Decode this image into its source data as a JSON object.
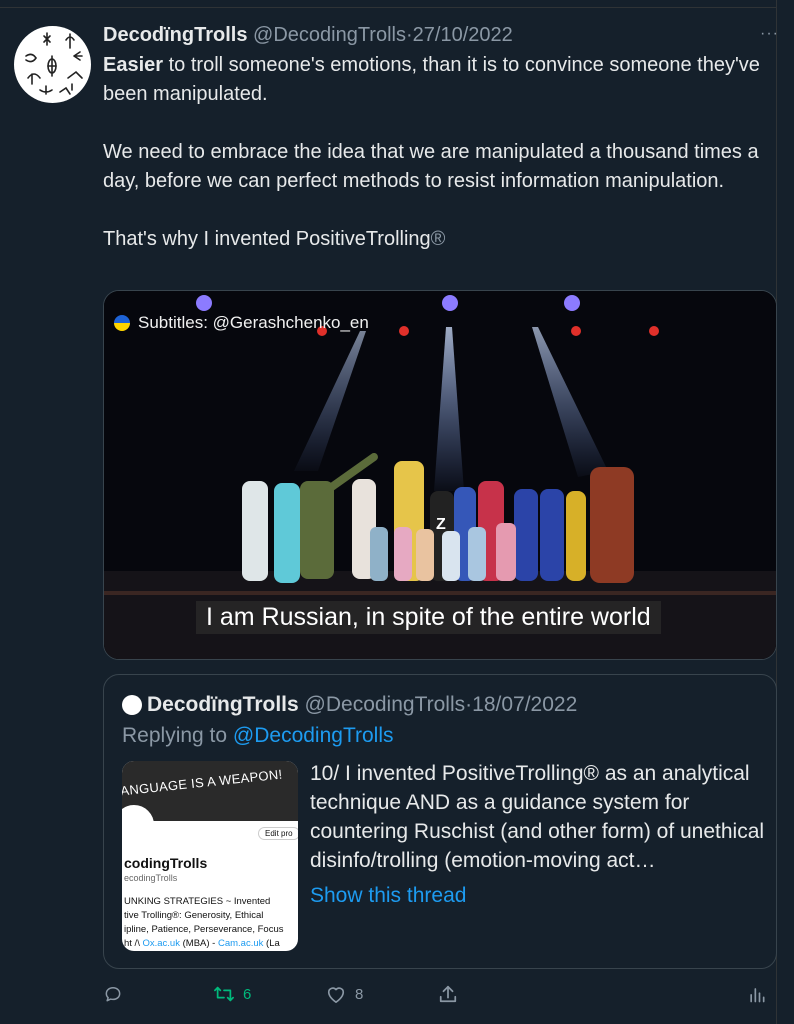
{
  "tweet": {
    "author_name": "DecodïngTrolls",
    "author_handle": "@DecodingTrolls",
    "separator": "·",
    "date": "27/10/2022",
    "more": "···",
    "body_bold": "Easier",
    "body_line1": " to troll someone's emotions, than it is to convince someone they've been manipulated.",
    "body_para2": "We need to embrace the idea that we are manipulated a thousand times a day, before we can perfect methods to resist information manipulation.",
    "body_para3": "That's why I invented PositiveTrolling",
    "registered": "®"
  },
  "video": {
    "subtitle_tag": "Subtitles: @Gerashchenko_en",
    "caption": "I am Russian, in spite of the entire world"
  },
  "quoted": {
    "author_name": "DecodïngTrolls",
    "author_handle": "@DecodingTrolls",
    "separator": "·",
    "date": "18/07/2022",
    "replying_prefix": "Replying to ",
    "replying_handle": "@DecodingTrolls",
    "text": "10/ I invented PositiveTrolling® as an analytical technique AND as a guidance system for countering Ruschist (and other form) of unethical disinfo/trolling (emotion-moving act…",
    "show_thread": "Show this thread",
    "thumb": {
      "banner": "ANGUAGE IS A WEAPON!",
      "edit": "Edit pro",
      "name": "codingTrolls",
      "handle": "ecodingTrolls",
      "bio1": "UNKING STRATEGIES ~ Invented",
      "bio2": "tive Trolling®: Generosity, Ethical",
      "bio3": "ipline, Patience, Perseverance, Focus",
      "bio4a": "ht /\\ ",
      "bio4b": "Ox.ac.uk",
      "bio4c": " (MBA) - ",
      "bio4d": "Cam.ac.uk",
      "bio4e": " (La"
    }
  },
  "actions": {
    "reply_icon": "comment-icon",
    "retweet_icon": "retweet-icon",
    "retweet_count": "6",
    "like_icon": "heart-icon",
    "like_count": "8",
    "share_icon": "share-icon",
    "analytics_icon": "analytics-icon"
  },
  "colors": {
    "background": "#15202b",
    "link": "#1d9bf0",
    "muted": "#8b98a5",
    "retweet": "#00ba7c"
  }
}
